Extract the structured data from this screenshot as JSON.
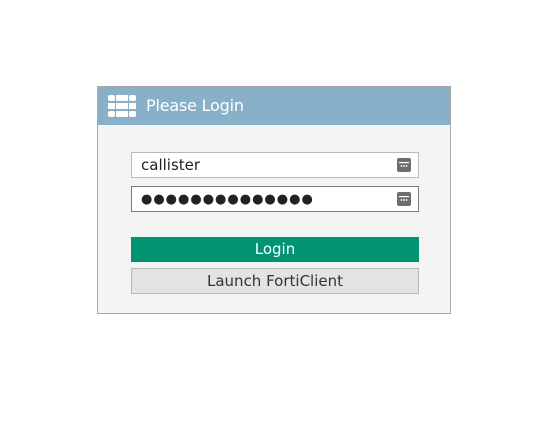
{
  "dialog": {
    "title": "Please Login",
    "logo_icon": "fortinet-grid-icon",
    "header_color": "#89b0c9"
  },
  "form": {
    "username": {
      "value": "callister",
      "icon": "password-manager-icon"
    },
    "password": {
      "value": "●●●●●●●●●●●●●●",
      "icon": "password-manager-icon"
    }
  },
  "buttons": {
    "login_label": "Login",
    "login_color": "#009473",
    "forticlient_label": "Launch FortiClient"
  }
}
